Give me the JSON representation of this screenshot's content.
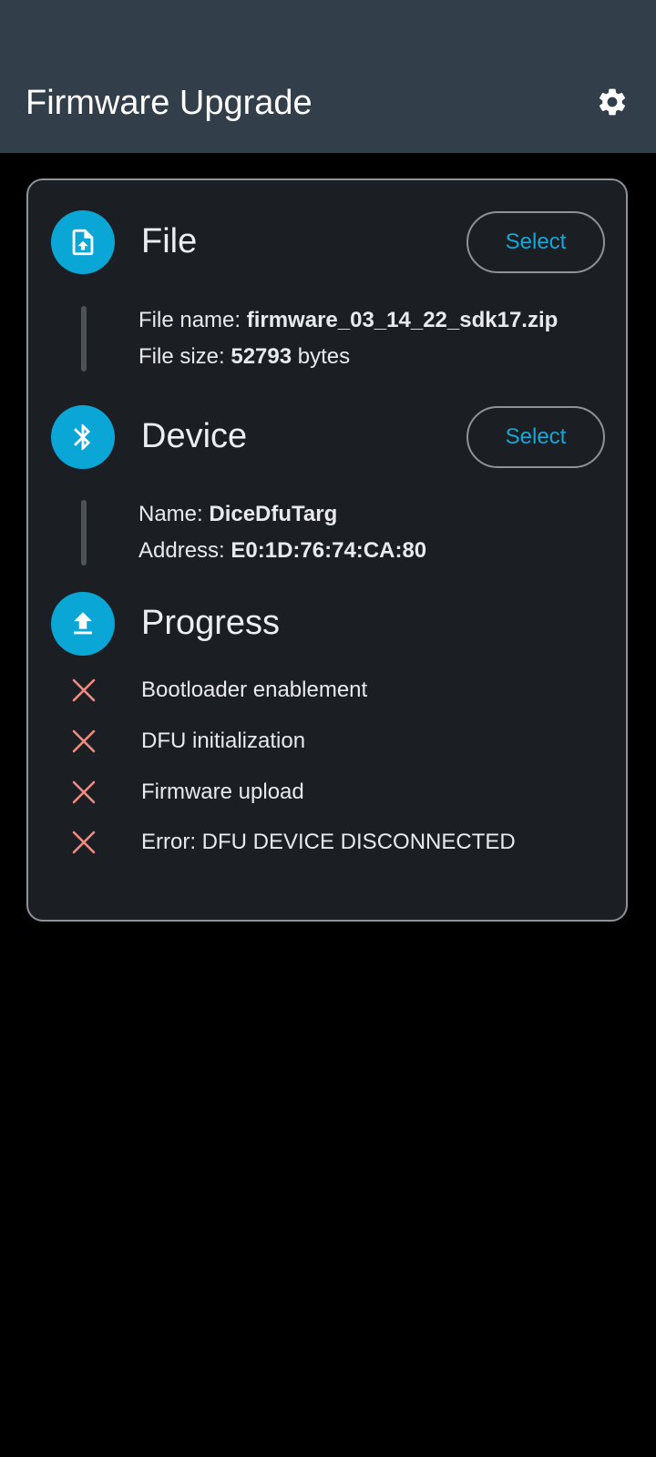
{
  "appbar": {
    "title": "Firmware Upgrade",
    "settings_icon": "gear-icon"
  },
  "colors": {
    "appbar_bg": "#323f4b",
    "accent": "#0aa6d6",
    "error": "#f28b82",
    "card_bg": "#1b1e22"
  },
  "file": {
    "title": "File",
    "icon": "file-upload-icon",
    "select_label": "Select",
    "name_label": "File name: ",
    "name_value": "firmware_03_14_22_sdk17.zip",
    "size_label": "File size: ",
    "size_value": "52793",
    "size_unit": " bytes"
  },
  "device": {
    "title": "Device",
    "icon": "bluetooth-icon",
    "select_label": "Select",
    "name_label": "Name: ",
    "name_value": "DiceDfuTarg",
    "address_label": "Address: ",
    "address_value": "E0:1D:76:74:CA:80"
  },
  "progress": {
    "title": "Progress",
    "icon": "upload-icon",
    "steps": [
      {
        "label": "Bootloader enablement",
        "status_icon": "close-icon"
      },
      {
        "label": "DFU initialization",
        "status_icon": "close-icon"
      },
      {
        "label": "Firmware upload",
        "status_icon": "close-icon"
      },
      {
        "label": "Error: DFU DEVICE DISCONNECTED",
        "status_icon": "close-icon"
      }
    ]
  }
}
